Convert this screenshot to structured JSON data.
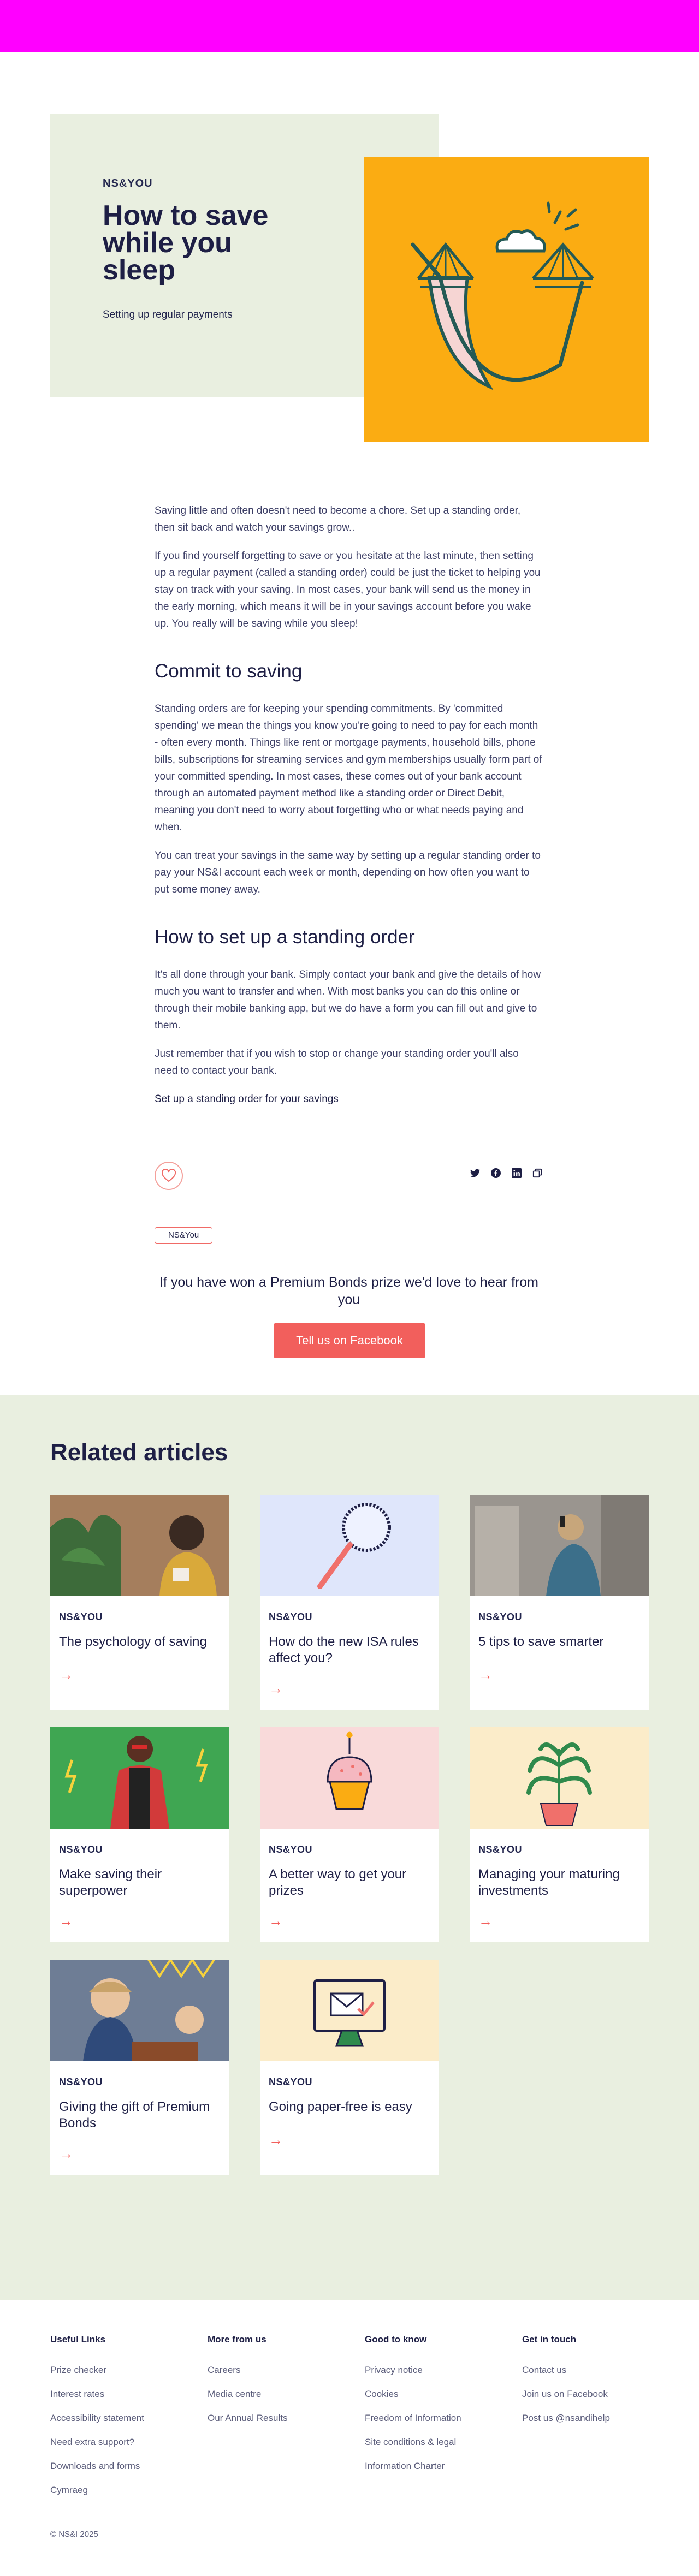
{
  "colors": {
    "topbar": "#ff00ff",
    "hero_green": "#e9efe0",
    "hero_orange": "#fbac12",
    "accent": "#f25f5c",
    "navy": "#1e1f45"
  },
  "hero": {
    "eyebrow": "NS&YOU",
    "title": "How to save while you sleep",
    "subtitle": "Setting up regular payments",
    "image_icon": "hammock-illustration"
  },
  "article": {
    "p1": "Saving little and often doesn't need to become a chore. Set up a standing order, then sit back and watch your savings grow..",
    "p2": "If you find yourself forgetting to save or you hesitate at the last minute, then setting up a regular payment (called a standing order) could be just the ticket to helping you stay on track with your saving. In most cases, your bank will send us the money in the early morning, which means it will be in your savings account before you wake up. You really will be saving while you sleep!",
    "h1": "Commit to saving",
    "p3": "Standing orders are for keeping your spending commitments. By 'committed spending' we mean the things you know you're going to need to pay for each month - often every month. Things like rent or mortgage payments, household bills, phone bills, subscriptions for streaming services and gym memberships usually form part of your committed spending. In most cases, these comes out of your bank account through an automated payment method like a standing order or Direct Debit, meaning you don't need to worry about forgetting who or what needs paying and when.",
    "p4": "You can treat your savings in the same way by setting up a regular standing order to pay your NS&I account each week or month, depending on how often you want to put some money away.",
    "h2": "How to set up a standing order",
    "p5": "It's all done through your bank. Simply contact your bank and give the details of how much you want to transfer and when. With most banks you can do this online or through their mobile banking app, but we do have a form you can fill out and give to them.",
    "p6": "Just remember that if you wish to stop or change your standing order you'll also need to contact your bank.",
    "link": "Set up a standing order for your savings"
  },
  "share": {
    "icons": [
      "twitter-icon",
      "facebook-icon",
      "linkedin-icon",
      "copy-link-icon"
    ],
    "like_icon": "heart-icon"
  },
  "tag": "NS&You",
  "cta": {
    "title": "If you have won a Premium Bonds prize we'd love to hear from you",
    "button": "Tell us on Facebook"
  },
  "related": {
    "title": "Related articles",
    "cards": [
      {
        "eyebrow": "NS&YOU",
        "title": "The psychology of saving",
        "image": "woman-with-plants-photo",
        "bg": "#b68f6e"
      },
      {
        "eyebrow": "NS&YOU",
        "title": "How do the new ISA rules affect you?",
        "image": "magnifying-glass-illustration",
        "bg": "#dfe6fb"
      },
      {
        "eyebrow": "NS&YOU",
        "title": "5 tips to save smarter",
        "image": "woman-phone-city-photo",
        "bg": "#8f8a86"
      },
      {
        "eyebrow": "NS&YOU",
        "title": "Make saving their superpower",
        "image": "child-superhero-photo",
        "bg": "#3fa652"
      },
      {
        "eyebrow": "NS&YOU",
        "title": "A better way to get your prizes",
        "image": "cupcake-illustration",
        "bg": "#f9dada"
      },
      {
        "eyebrow": "NS&YOU",
        "title": "Managing your maturing investments",
        "image": "plant-pot-illustration",
        "bg": "#fbecc9"
      },
      {
        "eyebrow": "NS&YOU",
        "title": "Giving the gift of Premium Bonds",
        "image": "child-birthday-cake-photo",
        "bg": "#6e7d95"
      },
      {
        "eyebrow": "NS&YOU",
        "title": "Going paper-free is easy",
        "image": "email-computer-illustration",
        "bg": "#fbecc9"
      }
    ],
    "arrow": "→"
  },
  "footer": {
    "cols": [
      {
        "title": "Useful Links",
        "links": [
          "Prize checker",
          "Interest rates",
          "Accessibility statement",
          "Need extra support?",
          "Downloads and forms",
          "Cymraeg"
        ]
      },
      {
        "title": "More from us",
        "links": [
          "Careers",
          "Media centre",
          "Our Annual Results"
        ]
      },
      {
        "title": "Good to know",
        "links": [
          "Privacy notice",
          "Cookies",
          "Freedom of Information",
          "Site conditions & legal",
          "Information Charter"
        ]
      },
      {
        "title": "Get in touch",
        "links": [
          "Contact us",
          "Join us on Facebook",
          "Post us @nsandihelp"
        ]
      }
    ],
    "copyright": "© NS&I 2025"
  }
}
